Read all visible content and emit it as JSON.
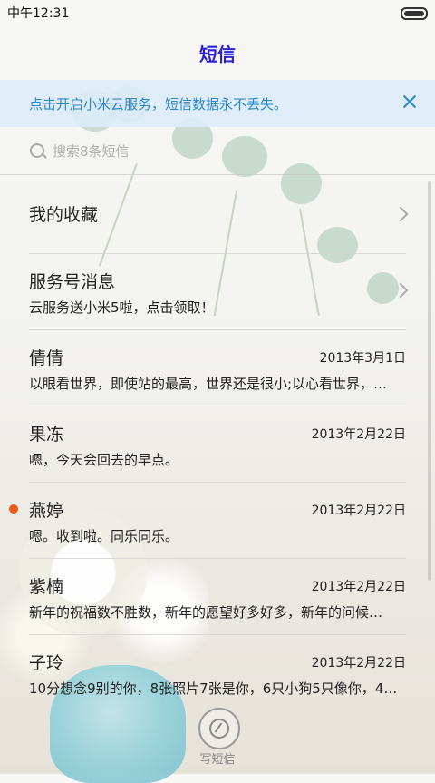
{
  "status_bar": {
    "time": "中午12:31"
  },
  "header": {
    "title": "短信"
  },
  "banner": {
    "text": "点击开启小米云服务，短信数据永不丢失。",
    "accent": "#2b86d0"
  },
  "search": {
    "placeholder": "搜索8条短信"
  },
  "list": [
    {
      "name": "我的收藏",
      "date": "",
      "message": "",
      "chevron": true,
      "unread": false
    },
    {
      "name": "服务号消息",
      "date": "",
      "message": "云服务送小米5啦，点击领取！",
      "chevron": true,
      "unread": false
    },
    {
      "name": "倩倩",
      "date": "2013年3月1日",
      "message": "以眼看世界，即使站的最高，世界还是很小;以心看世界，…",
      "chevron": false,
      "unread": false
    },
    {
      "name": "果冻",
      "date": "2013年2月22日",
      "message": "嗯，今天会回去的早点。",
      "chevron": false,
      "unread": false
    },
    {
      "name": "燕婷",
      "date": "2013年2月22日",
      "message": "嗯。收到啦。同乐同乐。",
      "chevron": false,
      "unread": true
    },
    {
      "name": "紫楠",
      "date": "2013年2月22日",
      "message": "新年的祝福数不胜数，新年的愿望好多好多，新年的问候…",
      "chevron": false,
      "unread": false
    },
    {
      "name": "子玲",
      "date": "2013年2月22日",
      "message": "10分想念9别的你，8张照片7张是你，6只小狗5只像你，4…",
      "chevron": false,
      "unread": false
    }
  ],
  "compose": {
    "label": "写短信"
  },
  "colors": {
    "title": "#2a1fd6",
    "unread_dot": "#f05a1a"
  }
}
